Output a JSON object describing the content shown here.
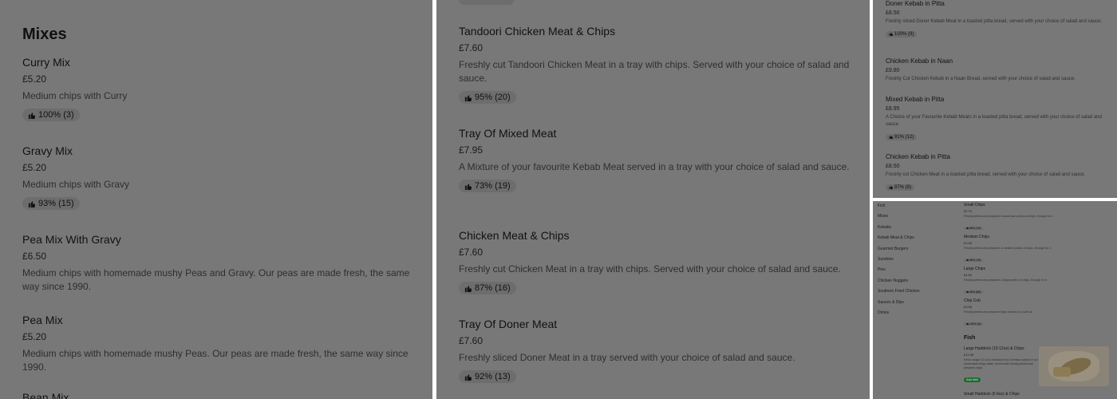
{
  "panel1": {
    "heading": "Mixes",
    "items": [
      {
        "title": "Curry Mix",
        "price": "£5.20",
        "desc": "Medium chips with Curry",
        "rating": "100% (3)"
      },
      {
        "title": "Gravy Mix",
        "price": "£5.20",
        "desc": "Medium chips with Gravy",
        "rating": "93% (15)"
      },
      {
        "title": "Pea Mix With Gravy",
        "price": "£6.50",
        "desc": "Medium chips with homemade mushy Peas and Gravy. Our peas are made fresh, the same way since 1990.",
        "rating": ""
      },
      {
        "title": "Pea Mix",
        "price": "£5.20",
        "desc": "Medium chips with homemade mushy Peas. Our peas are made fresh, the same way since 1990.",
        "rating": ""
      },
      {
        "title": "Bean Mix",
        "price": "",
        "desc": "",
        "rating": ""
      }
    ]
  },
  "panel2": {
    "items": [
      {
        "title": "Tandoori Chicken Meat & Chips",
        "price": "£7.60",
        "desc": "Freshly cut Tandoori Chicken Meat in a tray with chips. Served with your choice of salad and sauce.",
        "rating": "95% (20)"
      },
      {
        "title": "Tray Of Mixed Meat",
        "price": "£7.95",
        "desc": "A Mixture of your favourite Kebab Meat served in a tray with your choice of salad and sauce.",
        "rating": "73% (19)"
      },
      {
        "title": "Chicken Meat & Chips",
        "price": "£7.60",
        "desc": "Freshly cut Chicken Meat in a tray with chips. Served with your choice of salad and sauce.",
        "rating": "87% (16)"
      },
      {
        "title": "Tray Of Doner Meat",
        "price": "£7.60",
        "desc": "Freshly sliced Doner Meat in a tray served with your choice of salad and sauce.",
        "rating": "92% (13)"
      }
    ]
  },
  "panel3": {
    "items": [
      {
        "title": "Doner Kebab in Pitta",
        "price": "£8.50",
        "desc": "Freshly sliced Doner Kebab Meat in a toasted pitta bread, served with your choice of salad and sauce.",
        "rating": "100% (9)"
      },
      {
        "title": "Chicken Kebab in Naan",
        "price": "£9.80",
        "desc": "Freshly Cut Chicken Kebab in a Naan Bread, served with your choice of salad and sauce.",
        "rating": ""
      },
      {
        "title": "Mixed Kebab in Pitta",
        "price": "£8.95",
        "desc": "A Choice of your Favourite Kebab Meats in a toasted pitta bread, served with your choice of salad and sauce.",
        "rating": "91% (12)"
      },
      {
        "title": "Chicken Kebab in Pitta",
        "price": "£8.50",
        "desc": "Freshly cut Chicken Meat in a toasted pitta bread, served with your choice of salad and sauce.",
        "rating": "87% (8)"
      }
    ]
  },
  "panel4": {
    "nav": [
      "Fish",
      "Mixes",
      "Kebabs",
      "Kebab Meat & Chips",
      "Gourmet Burgers",
      "Sundries",
      "Pies",
      "Chicken Nuggets",
      "Southern Fried Chicken",
      "Sauces & Dips",
      "Drinks"
    ],
    "items": [
      {
        "title": "Small Chips",
        "price": "£2.70",
        "desc": "Freshly peeled and prepared. A small size portion of chips. Enough for 1.",
        "rating": "98% (76)"
      },
      {
        "title": "Medium Chips",
        "price": "£3.45",
        "desc": "Freshly peeled and prepared. A medium portion of chips. Enough for 2.",
        "rating": "98% (78)"
      },
      {
        "title": "Large Chips",
        "price": "£4.90",
        "desc": "Freshly peeled and prepared. A large portion of chips. Enough for 3.",
        "rating": "98% (88)"
      },
      {
        "title": "Chip Cob",
        "price": "£3.95",
        "desc": "Freshly peeled and prepared chips served on a soft roll.",
        "rating": "100% (3)"
      }
    ],
    "fish_heading": "Fish",
    "fish_items": [
      {
        "title": "Large Haddock (10-12oz) & Chips",
        "price": "£12.99",
        "desc": "Fresh caught 10-12oz Haddock from Grimsby cooked in our homemade crispy batter, served with freshly peeled and prepared chips.",
        "badge": "Sold Well"
      },
      {
        "title": "Small Haddock (5-6oz) & Chips"
      }
    ]
  },
  "colors": {
    "overlay": "#787878",
    "pill": "#6d6d6d",
    "badge": "#1b6b2e"
  }
}
